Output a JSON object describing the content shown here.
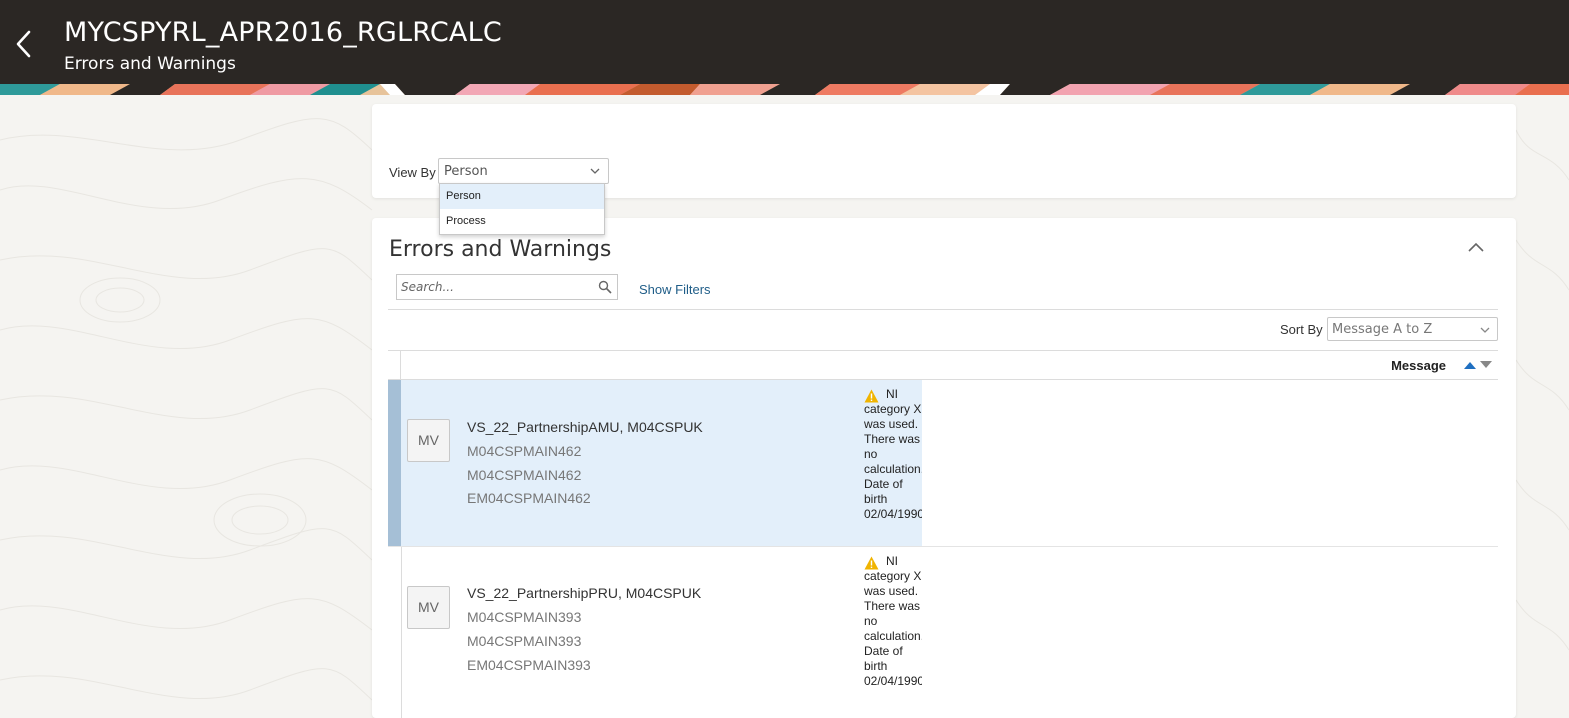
{
  "header": {
    "title": "MYCSPYRL_APR2016_RGLRCALC",
    "subtitle": "Errors and Warnings",
    "back_icon": "chevron-left-icon"
  },
  "view_by": {
    "label": "View By",
    "selected": "Person",
    "options": [
      "Person",
      "Process"
    ]
  },
  "errors_section": {
    "title": "Errors and Warnings",
    "search_placeholder": "Search...",
    "show_filters": "Show Filters",
    "sort_by_label": "Sort By",
    "sort_by_value": "Message A to Z",
    "column_message": "Message"
  },
  "rows": [
    {
      "initials": "MV",
      "name": "VS_22_PartnershipAMU, M04CSPUK",
      "line1": "M04CSPMAIN462",
      "line2": "M04CSPMAIN462",
      "line3": "EM04CSPMAIN462",
      "message": "NI category X was used. There was no calculation. Date of birth 02/04/1990",
      "selected": true
    },
    {
      "initials": "MV",
      "name": "VS_22_PartnershipPRU, M04CSPUK",
      "line1": "M04CSPMAIN393",
      "line2": "M04CSPMAIN393",
      "line3": "EM04CSPMAIN393",
      "message": "NI category X was used. There was no calculation. Date of birth 02/04/1990",
      "selected": false
    }
  ],
  "colors": {
    "header_bg": "#2b2724",
    "link": "#1f5d88",
    "selected_row": "#e3effa",
    "warning": "#f0b400",
    "sort_active": "#1f6fc1"
  }
}
